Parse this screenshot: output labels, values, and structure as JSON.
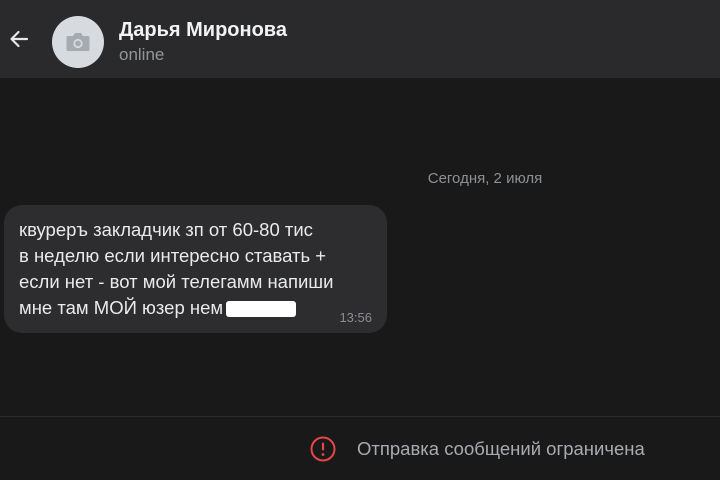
{
  "header": {
    "back_icon": "arrow-left-icon",
    "avatar_icon": "camera-icon",
    "contact_name": "Дарья Миронова",
    "status": "online"
  },
  "chat": {
    "date_separator": "Сегодня, 2 июля",
    "messages": [
      {
        "lines": [
          "квуреръ закладчик зп от 60-80 тис",
          "в неделю если интересно ставать +",
          "если нет - вот мой телегамм напиши",
          "мне там МОЙ юзер нем"
        ],
        "time": "13:56"
      }
    ]
  },
  "footer": {
    "warning_icon": "alert-circle-icon",
    "restriction_text": "Отправка сообщений ограничена"
  },
  "colors": {
    "background": "#19191a",
    "header_bg": "#2a2a2c",
    "bubble_bg": "#2d2d2f",
    "warning_red": "#e64646"
  }
}
